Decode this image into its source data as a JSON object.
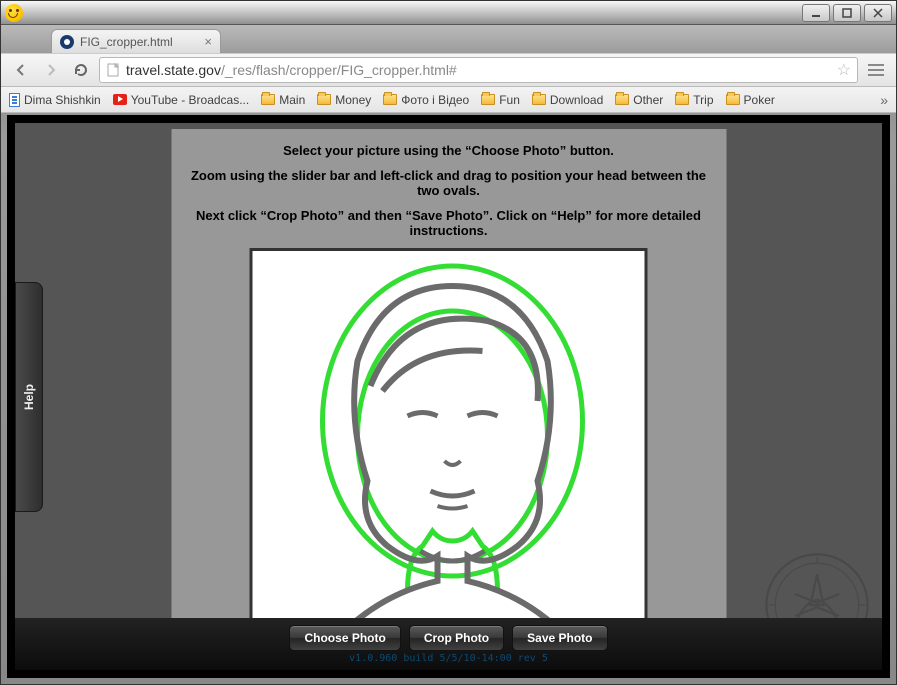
{
  "tab": {
    "title": "FIG_cropper.html"
  },
  "url": {
    "domain": "travel.state.gov",
    "path": "/_res/flash/cropper/FIG_cropper.html#"
  },
  "bookmarks": [
    {
      "label": "Dima Shishkin",
      "icon": "doc"
    },
    {
      "label": "YouTube - Broadcas...",
      "icon": "yt"
    },
    {
      "label": "Main",
      "icon": "folder"
    },
    {
      "label": "Money",
      "icon": "folder"
    },
    {
      "label": "Фото і Відео",
      "icon": "folder"
    },
    {
      "label": "Fun",
      "icon": "folder"
    },
    {
      "label": "Download",
      "icon": "folder"
    },
    {
      "label": "Other",
      "icon": "folder"
    },
    {
      "label": "Trip",
      "icon": "folder"
    },
    {
      "label": "Poker",
      "icon": "folder"
    }
  ],
  "help_tab": "Help",
  "instructions": {
    "line1": "Select your picture using the “Choose Photo” button.",
    "line2": "Zoom using the slider bar and left-click and drag to position your head between the two ovals.",
    "line3": "Next click “Crop Photo” and then “Save Photo”.  Click on “Help” for more detailed instructions."
  },
  "buttons": {
    "choose": "Choose Photo",
    "crop": "Crop Photo",
    "save": "Save Photo"
  },
  "build_info": "v1.0.960 build 5/5/10-14:00 rev 5"
}
